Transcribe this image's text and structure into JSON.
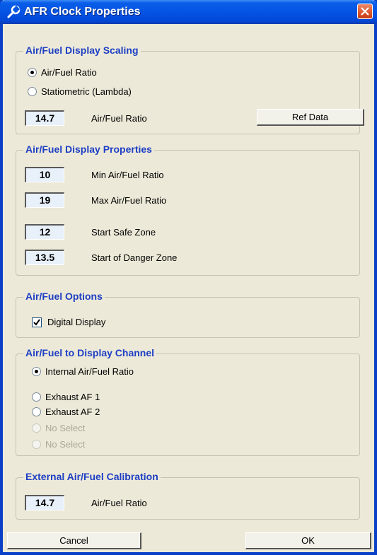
{
  "window": {
    "title": "AFR Clock Properties"
  },
  "scaling": {
    "title": "Air/Fuel Display Scaling",
    "radio_afr": "Air/Fuel Ratio",
    "radio_lambda": "Statiometric (Lambda)",
    "stoich_value": "14.7",
    "stoich_label": "Air/Fuel Ratio",
    "ref_button": "Ref Data"
  },
  "properties": {
    "title": "Air/Fuel Display Properties",
    "min_value": "10",
    "min_label": "Min Air/Fuel Ratio",
    "max_value": "19",
    "max_label": "Max Air/Fuel Ratio",
    "safe_value": "12",
    "safe_label": "Start Safe Zone",
    "danger_value": "13.5",
    "danger_label": "Start of Danger Zone"
  },
  "options": {
    "title": "Air/Fuel Options",
    "digital_display": "Digital Display",
    "digital_display_checked": true
  },
  "channel": {
    "title": "Air/Fuel to Display Channel",
    "internal": "Internal Air/Fuel Ratio",
    "exhaust1": "Exhaust AF 1",
    "exhaust2": "Exhaust AF 2",
    "no_select_1": "No Select",
    "no_select_2": "No Select"
  },
  "calibration": {
    "title": "External Air/Fuel Calibration",
    "value": "14.7",
    "label": "Air/Fuel Ratio"
  },
  "footer": {
    "cancel": "Cancel",
    "ok": "OK"
  }
}
